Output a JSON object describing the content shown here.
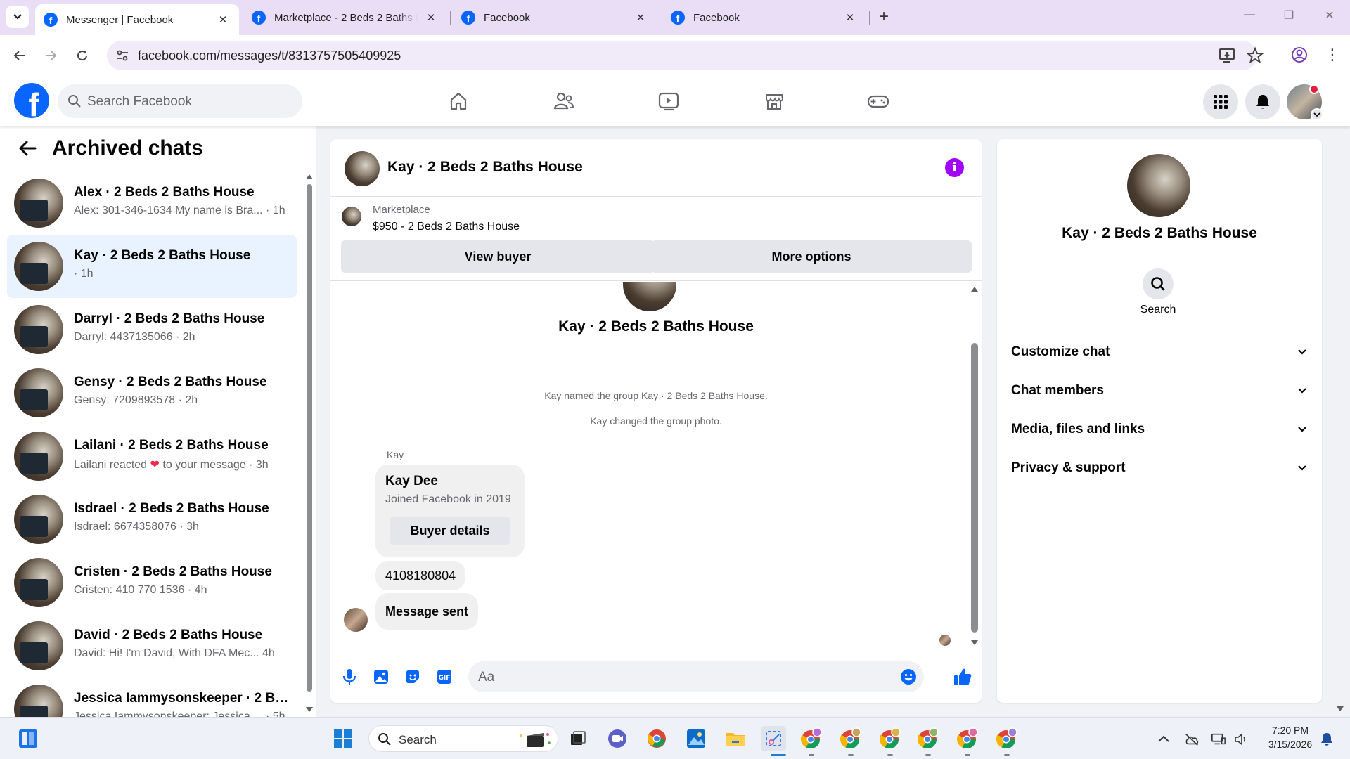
{
  "browser": {
    "tabs": [
      {
        "title": "Messenger | Facebook",
        "active": true
      },
      {
        "title": "Marketplace - 2 Beds 2 Baths H",
        "active": false
      },
      {
        "title": "Facebook",
        "active": false
      },
      {
        "title": "Facebook",
        "active": false
      }
    ],
    "url": "facebook.com/messages/t/8313757505409925"
  },
  "fb": {
    "search_placeholder": "Search Facebook"
  },
  "archived": {
    "title": "Archived chats",
    "chats": [
      {
        "name": "Alex · 2 Beds 2 Baths House",
        "preview": "Alex: 301-346-1634 My name is Bra... · 1h",
        "active": false
      },
      {
        "name": "Kay · 2 Beds 2 Baths House",
        "preview": "· 1h",
        "active": true
      },
      {
        "name": "Darryl · 2 Beds 2 Baths House",
        "preview": "Darryl: 4437135066 · 2h",
        "active": false
      },
      {
        "name": "Gensy · 2 Beds 2 Baths House",
        "preview": "Gensy: 7209893578 · 2h",
        "active": false
      },
      {
        "name": "Lailani · 2 Beds 2 Baths House",
        "preview_pre": "Lailani reacted",
        "preview_post": "to your message · 3h",
        "active": false
      },
      {
        "name": "Isdrael · 2 Beds 2 Baths House",
        "preview": "Isdrael: 6674358076 · 3h",
        "active": false
      },
      {
        "name": "Cristen · 2 Beds 2 Baths House",
        "preview": "Cristen: 410 770 1536 · 4h",
        "active": false
      },
      {
        "name": "David · 2 Beds 2 Baths House",
        "preview": "David: Hi! I'm David, With DFA Mec...   4h",
        "active": false
      },
      {
        "name": "Jessica Iammysonskeeper · 2 Be...",
        "preview": "Jessica Iammysonskeeper: Jessica ... · 5h",
        "active": false
      }
    ]
  },
  "conversation": {
    "title": "Kay · 2 Beds 2 Baths House",
    "marketplace_label": "Marketplace",
    "listing": "$950 - 2 Beds 2 Baths House",
    "view_buyer": "View buyer",
    "more_options": "More options",
    "thread_name": "Kay · 2 Beds 2 Baths House",
    "system_messages": [
      "Kay named the group Kay · 2 Beds 2 Baths House.",
      "Kay changed the group photo."
    ],
    "sender": "Kay",
    "card": {
      "name": "Kay Dee",
      "sub": "Joined Facebook in 2019",
      "button": "Buyer details"
    },
    "messages": [
      "4108180804",
      "Message sent"
    ],
    "composer_placeholder": "Aa"
  },
  "info": {
    "name": "Kay · 2 Beds 2 Baths House",
    "search_label": "Search",
    "sections": [
      "Customize chat",
      "Chat members",
      "Media, files and links",
      "Privacy & support"
    ]
  },
  "taskbar": {
    "search_placeholder": "Search",
    "time": "7:20 PM",
    "date": "3/15/2026"
  },
  "colors": {
    "accent": "#0866ff",
    "info_button": "#a100ff",
    "active_chat_bg": "#e8f3ff"
  }
}
